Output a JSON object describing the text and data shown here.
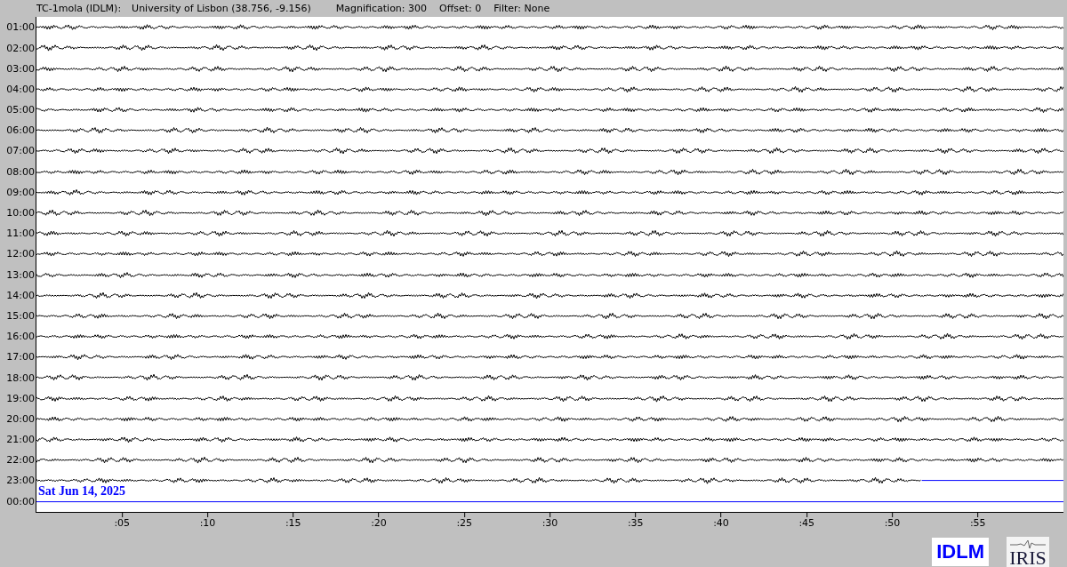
{
  "header": {
    "station": "TC-1mola (IDLM):",
    "location": "University of Lisbon (38.756, -9.156)",
    "magnification": "Magnification: 300",
    "offset": "Offset: 0",
    "filter": "Filter: None"
  },
  "rows": [
    {
      "time": "01:00",
      "level": 1
    },
    {
      "time": "02:00",
      "level": 1
    },
    {
      "time": "03:00",
      "level": 1
    },
    {
      "time": "04:00",
      "level": 1
    },
    {
      "time": "05:00",
      "level": 1
    },
    {
      "time": "06:00",
      "level": 1
    },
    {
      "time": "07:00",
      "level": 1
    },
    {
      "time": "08:00",
      "level": 1
    },
    {
      "time": "09:00",
      "level": 1
    },
    {
      "time": "10:00",
      "level": 1
    },
    {
      "time": "11:00",
      "level": 1
    },
    {
      "time": "12:00",
      "level": 1
    },
    {
      "time": "13:00",
      "level": 1
    },
    {
      "time": "14:00",
      "level": 1
    },
    {
      "time": "15:00",
      "level": 1
    },
    {
      "time": "16:00",
      "level": 1
    },
    {
      "time": "17:00",
      "level": 1
    },
    {
      "time": "18:00",
      "level": 1
    },
    {
      "time": "19:00",
      "level": 1
    },
    {
      "time": "20:00",
      "level": 1
    },
    {
      "time": "21:00",
      "level": 1
    },
    {
      "time": "22:00",
      "level": 1
    },
    {
      "time": "23:00",
      "level": 0.862
    },
    {
      "time": "00:00",
      "kind": "empty"
    }
  ],
  "date_label": "Sat Jun 14, 2025",
  "x_ticks": [
    ":05",
    ":10",
    ":15",
    ":20",
    ":25",
    ":30",
    ":35",
    ":40",
    ":45",
    ":50",
    ":55"
  ],
  "logos": {
    "network": "IDLM",
    "iris": "IRIS"
  }
}
